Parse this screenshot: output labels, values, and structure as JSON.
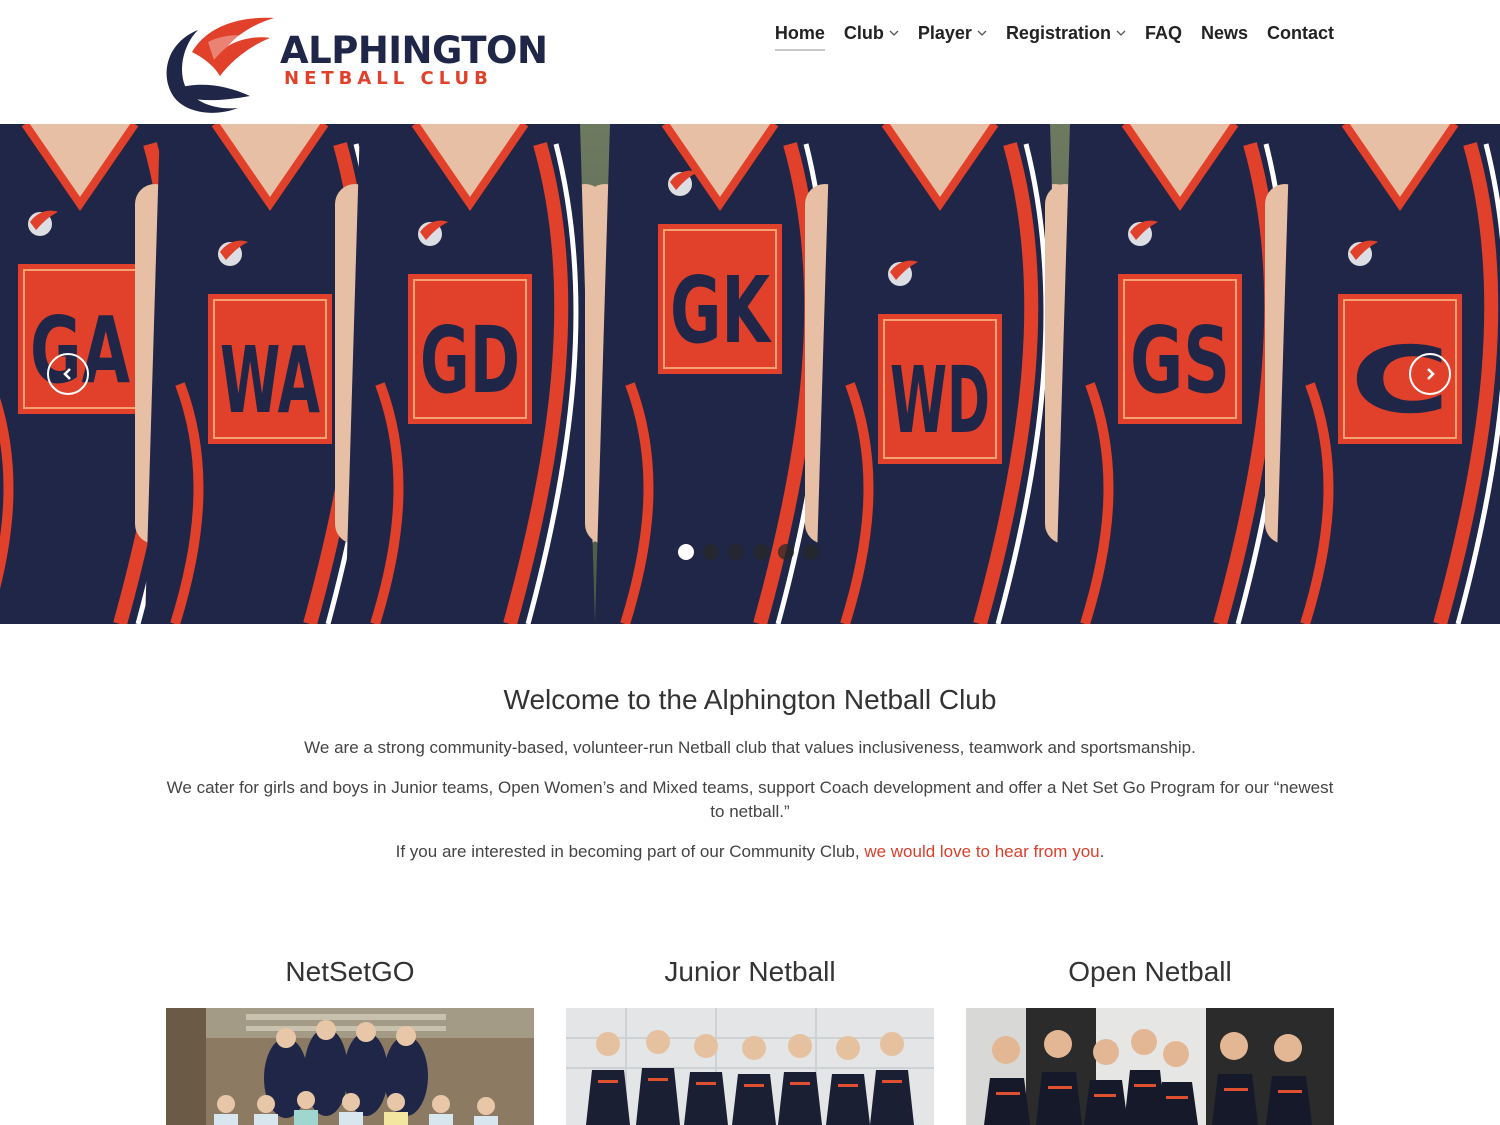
{
  "site": {
    "logo_line1": "ALPHINGTON",
    "logo_line2": "NETBALL CLUB",
    "brand_navy": "#1f2647",
    "brand_orange": "#e1412b"
  },
  "nav": {
    "items": [
      {
        "label": "Home",
        "dropdown": false,
        "active": true
      },
      {
        "label": "Club",
        "dropdown": true
      },
      {
        "label": "Player",
        "dropdown": true
      },
      {
        "label": "Registration",
        "dropdown": true
      },
      {
        "label": "FAQ",
        "dropdown": false
      },
      {
        "label": "News",
        "dropdown": false
      },
      {
        "label": "Contact",
        "dropdown": false
      }
    ]
  },
  "hero": {
    "bibs": [
      "GA",
      "WA",
      "GD",
      "GK",
      "WD",
      "GS",
      "C"
    ],
    "slide_count": 6,
    "active_slide": 1,
    "prev_icon": "chevron-left-icon",
    "next_icon": "chevron-right-icon"
  },
  "welcome": {
    "title": "Welcome to the Alphington Netball Club",
    "p1": "We are a strong community-based, volunteer-run Netball club that values inclusiveness, teamwork and sportsmanship.",
    "p2": "We cater for girls and boys in Junior teams, Open Women’s and Mixed teams, support Coach development and offer a Net Set Go Program for our “newest to netball.”",
    "p3_prefix": "If you are interested in becoming part of our Community Club, ",
    "p3_link": "we would love to hear from you",
    "p3_suffix": "."
  },
  "cards": [
    {
      "title": "NetSetGO"
    },
    {
      "title": "Junior Netball"
    },
    {
      "title": "Open Netball"
    }
  ]
}
